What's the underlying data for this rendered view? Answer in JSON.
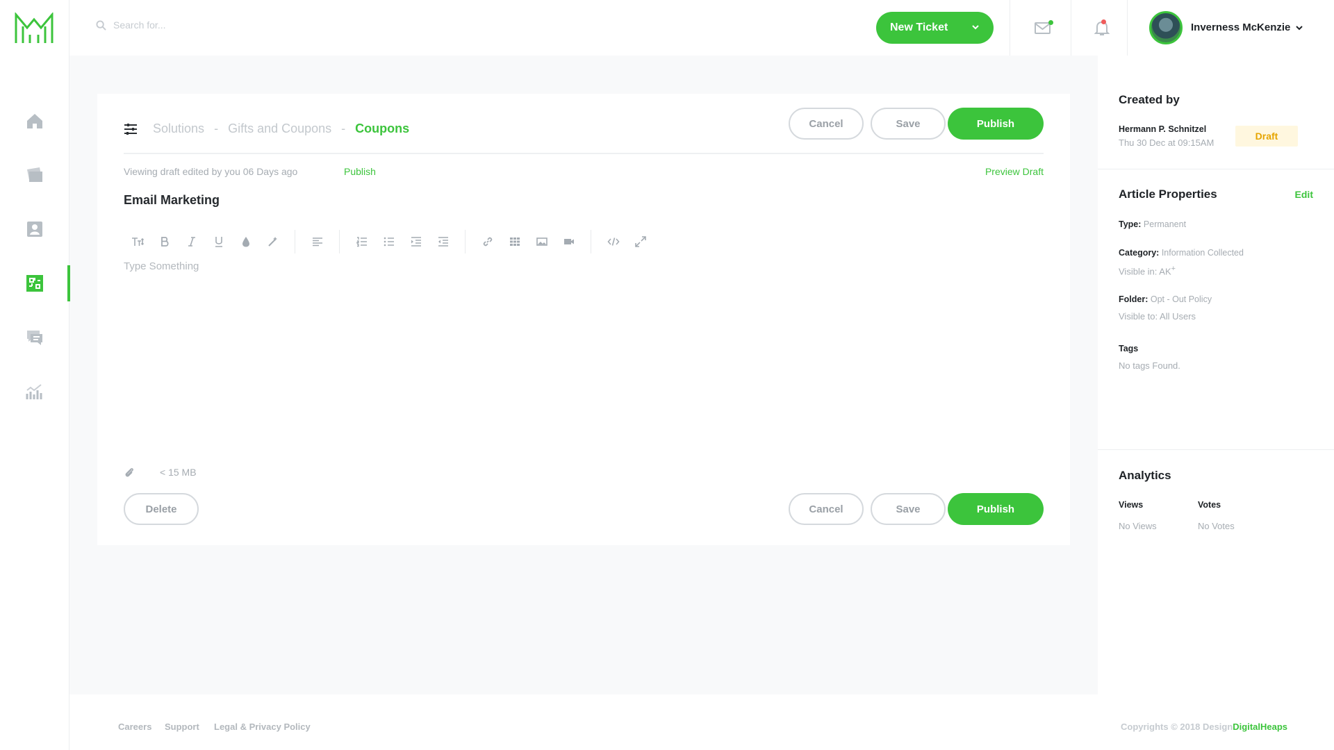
{
  "brand": {
    "accent": "#3cc43c"
  },
  "sidebar": {
    "items": [
      {
        "icon": "home-icon"
      },
      {
        "icon": "tickets-icon"
      },
      {
        "icon": "contacts-icon"
      },
      {
        "icon": "solutions-icon",
        "active": true
      },
      {
        "icon": "forums-icon"
      },
      {
        "icon": "analytics-icon"
      }
    ]
  },
  "topbar": {
    "search_placeholder": "Search for...",
    "new_ticket_label": "New Ticket",
    "user_name": "Inverness McKenzie"
  },
  "editor": {
    "breadcrumb": [
      "Solutions",
      "Gifts and Coupons",
      "Coupons"
    ],
    "breadcrumb_sep": "-",
    "cancel_label": "Cancel",
    "save_label": "Save",
    "publish_label": "Publish",
    "meta_text": "Viewing draft edited by you 06 Days ago",
    "meta_publish_link": "Publish",
    "preview_label": "Preview Draft",
    "title": "Email Marketing",
    "body_placeholder": "Type Something",
    "attachment_limit": "< 15 MB",
    "delete_label": "Delete"
  },
  "panel": {
    "created_by": {
      "heading": "Created by",
      "name": "Hermann P. Schnitzel",
      "date": "Thu 30 Dec at 09:15AM",
      "status": "Draft"
    },
    "properties": {
      "heading": "Article Properties",
      "edit_label": "Edit",
      "type_label": "Type:",
      "type_value": "Permanent",
      "category_label": "Category:",
      "category_value": "Information Collected",
      "visible_in": "Visible in: AK",
      "visible_in_sup": "+",
      "folder_label": "Folder:",
      "folder_value": "Opt - Out Policy",
      "visible_to": "Visible to: All Users",
      "tags_label": "Tags",
      "tags_value": "No tags Found."
    },
    "analytics": {
      "heading": "Analytics",
      "views_label": "Views",
      "views_value": "No Views",
      "votes_label": "Votes",
      "votes_value": "No Votes"
    }
  },
  "footer": {
    "links": [
      "Careers",
      "Support",
      "Legal & Privacy Policy"
    ],
    "copyright": "Copyrights © 2018 Design",
    "copyright_brand": "DigitalHeaps"
  }
}
